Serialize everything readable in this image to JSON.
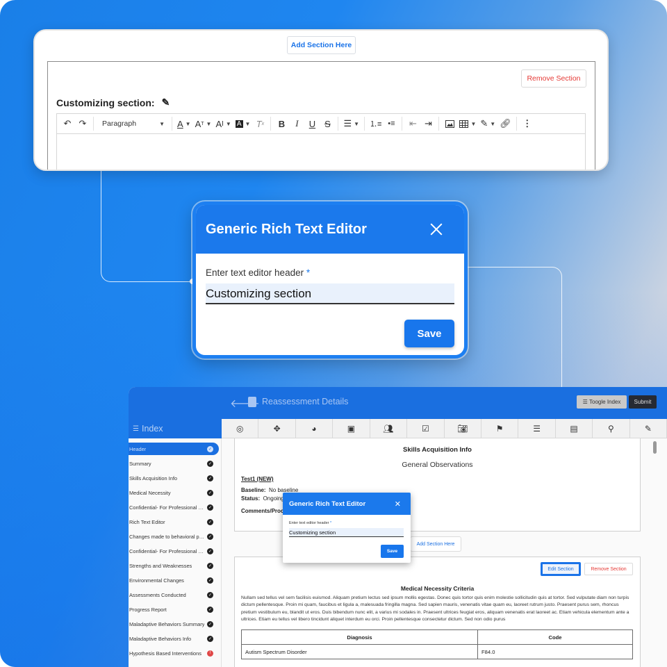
{
  "colors": {
    "accent": "#1b79ec",
    "danger": "#e53935",
    "warning": "#e04848"
  },
  "editor_card": {
    "add_section_label": "Add Section Here",
    "remove_section_label": "Remove Section",
    "section_title": "Customizing section:",
    "paragraph_style": "Paragraph",
    "toolbar_icons": [
      "undo-icon",
      "redo-icon",
      "font-color-icon",
      "font-size-icon",
      "text-case-icon",
      "highlight-text-icon",
      "clear-format-icon",
      "bold-icon",
      "italic-icon",
      "underline-icon",
      "strikethrough-icon",
      "align-icon",
      "numbered-list-icon",
      "bullet-list-icon",
      "outdent-icon",
      "indent-icon",
      "image-icon",
      "table-icon",
      "marker-icon",
      "link-icon",
      "more-icon"
    ]
  },
  "dialog": {
    "title": "Generic Rich Text Editor",
    "field_label": "Enter text editor header",
    "required_mark": "*",
    "field_value": "Customizing section",
    "save_label": "Save"
  },
  "app": {
    "page_title": "Reassessment Details",
    "toggle_index_label": "Toogle Index",
    "submit_label": "Submit",
    "index_title": "Index",
    "index_items": [
      {
        "label": "Header",
        "status": "complete",
        "active": true
      },
      {
        "label": "Summary",
        "status": "complete"
      },
      {
        "label": "Skills Acquisition Info",
        "status": "complete"
      },
      {
        "label": "Medical Necessity",
        "status": "complete"
      },
      {
        "label": "Confidential- For Professional U...",
        "status": "complete"
      },
      {
        "label": "Rich Text Editor",
        "status": "complete"
      },
      {
        "label": "Changes made to behavioral pro...",
        "status": "complete"
      },
      {
        "label": "Confidential- For Professional U...",
        "status": "complete"
      },
      {
        "label": "Strengths and Weaknesses",
        "status": "complete"
      },
      {
        "label": "Environmental Changes",
        "status": "complete"
      },
      {
        "label": "Assessments Conducted",
        "status": "complete"
      },
      {
        "label": "Progress Report",
        "status": "complete"
      },
      {
        "label": "Maladaptive Behaviors Summary",
        "status": "complete"
      },
      {
        "label": "Maladaptive Behaviors Info",
        "status": "complete"
      },
      {
        "label": "Hypothesis Based Interventions",
        "status": "warning"
      }
    ],
    "section_icons": [
      "target-icon",
      "move-icon",
      "pie-chart-icon",
      "presentation-icon",
      "people-icon",
      "checklist-icon",
      "camera-icon",
      "user-badge-icon",
      "sliders-icon",
      "abc-icon",
      "search-icon",
      "pen-icon"
    ],
    "skills": {
      "heading": "Skills Acquisition Info",
      "subheading": "General Observations",
      "target_name": "Test1 (NEW)",
      "baseline_label": "Baseline:",
      "baseline_value": "No baseline",
      "status_label": "Status:",
      "status_value": "Ongoing",
      "comments_label": "Comments/Proc"
    },
    "add_section_label": "Add Section Here",
    "edit_section_label": "Edit Section",
    "remove_section_label": "Remove Section",
    "criteria_heading": "Medical Necessity Criteria",
    "criteria_text": "Nullam sed tellus vel sem facilisis euismod. Aliquam pretium lectus sed ipsum mollis egestas. Donec quis tortor quis enim molestie sollicitudin quis at tortor. Sed vulputate diam non turpis dictum pellentesque. Proin mi quam, faucibus et ligula a, malesuada fringilla magna. Sed sapien mauris, venenatis vitae quam eu, laoreet rutrum justo. Praesent purus sem, rhoncus pretium vestibulum eu, blandit ut eros. Duis bibendum nunc elit, a varius mi sodales in. Praesent ultrices feugiat eros, aliquam venenatis erat laoreet ac. Etiam vehicula elementum ante a ultrices. Etiam eu tellus vel libero tincidunt aliquet interdum eu orci. Proin pellentesque consectetur dictum. Sed non odio purus",
    "diagnosis_table": {
      "headers": [
        "Diagnosis",
        "Code"
      ],
      "rows": [
        [
          "Autism Spectrum Disorder",
          "F84.0"
        ]
      ]
    },
    "dialog": {
      "title": "Generic Rich Text Editor",
      "field_label": "Enter text editor header",
      "required_mark": "*",
      "field_value": "Customizing section",
      "save_label": "Save"
    }
  }
}
